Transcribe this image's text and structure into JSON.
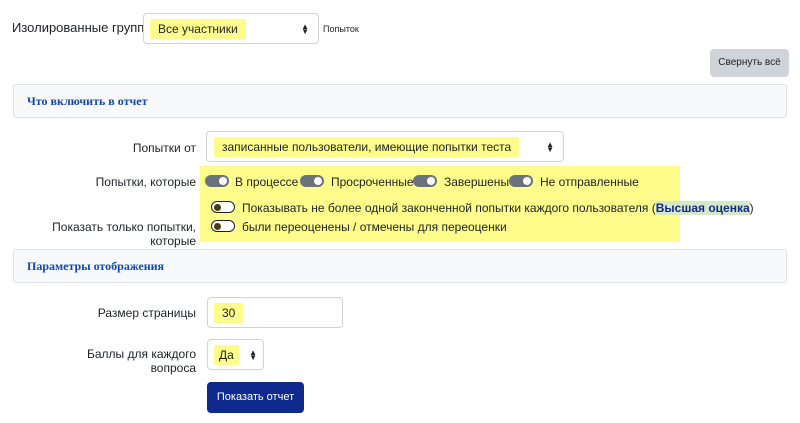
{
  "top": {
    "group_label": "Изолированные группы",
    "group_select_value": "Все участники",
    "attempts_text": "Попыток",
    "collapse_label": "Свернуть всё"
  },
  "section_include": {
    "title": "Что включить в отчет",
    "attempts_from_label": "Попытки от",
    "attempts_from_value": "записанные пользователи, имеющие попытки теста",
    "attempts_that_label": "Попытки, которые",
    "states": [
      {
        "label": "В процессе",
        "on": true
      },
      {
        "label": "Просроченные",
        "on": true
      },
      {
        "label": "Завершены",
        "on": true
      },
      {
        "label": "Не отправленные",
        "on": true
      }
    ],
    "show_only_label": "Показать только попытки, которые",
    "option_one_prefix": "Показывать не более одной законченной попытки каждого пользователя (",
    "option_one_link": "Высшая оценка",
    "option_one_suffix": ")",
    "option_two": "были переоценены / отмечены для переоценки"
  },
  "section_display": {
    "title": "Параметры отображения",
    "page_size_label": "Размер страницы",
    "page_size_value": "30",
    "marks_label": "Баллы для каждого вопроса",
    "marks_value": "Да",
    "submit_label": "Показать отчет"
  },
  "colors": {
    "highlight": "#fefc8a",
    "primary": "#0f2a8c",
    "section_title": "#0f47ad"
  }
}
